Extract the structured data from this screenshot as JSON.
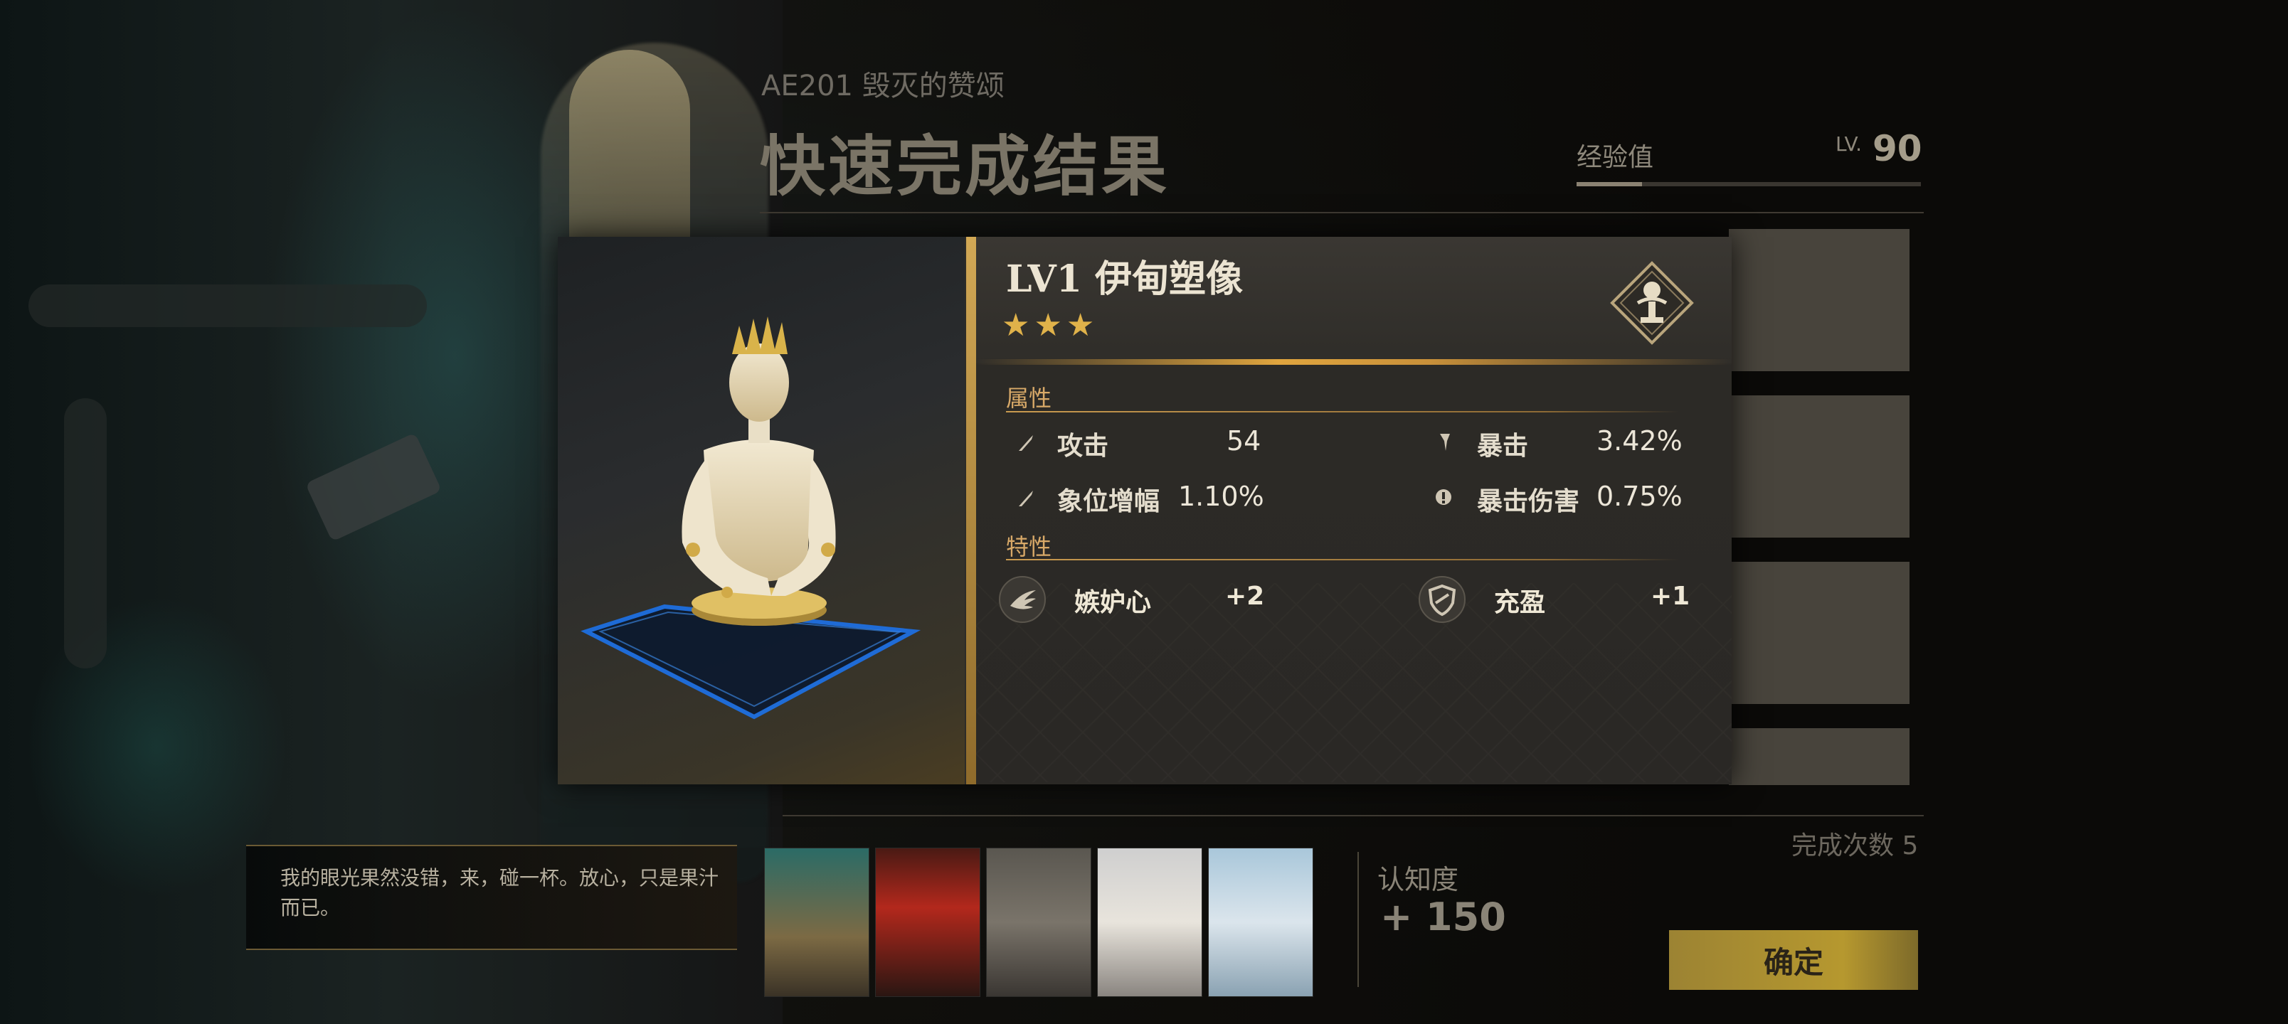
{
  "stage": {
    "subtitle": "AE201 毁灭的赞颂",
    "title": "快速完成结果"
  },
  "experience": {
    "label": "经验值",
    "lv_prefix": "LV.",
    "level": "90",
    "progress": 0.19
  },
  "completion": {
    "label": "完成次数 5"
  },
  "cognition": {
    "label": "认知度",
    "value": "+ 150"
  },
  "dialog": {
    "text": "我的眼光果然没错，来，碰一杯。放心，只是果汁而已。"
  },
  "confirm_button": {
    "label": "确定"
  },
  "item": {
    "name": "LV1   伊甸塑像",
    "stars": "★★★",
    "star_count": 3,
    "attributes_label": "属性",
    "traits_label": "特性",
    "stats": [
      {
        "name": "攻击",
        "value": "54",
        "icon": "sword-icon"
      },
      {
        "name": "暴击",
        "value": "3.42%",
        "icon": "crit-icon"
      },
      {
        "name": "象位增幅",
        "value": "1.10%",
        "icon": "sword-icon"
      },
      {
        "name": "暴击伤害",
        "value": "0.75%",
        "icon": "crit-damage-icon"
      }
    ],
    "traits": [
      {
        "name": "嫉妒心",
        "value": "+2",
        "icon": "wings-icon"
      },
      {
        "name": "充盈",
        "value": "+1",
        "icon": "shield-icon"
      }
    ]
  },
  "colors": {
    "accent_gold": "#d2a855",
    "button_gold": "#b6982f",
    "platform_blue": "#1e6fe0"
  }
}
